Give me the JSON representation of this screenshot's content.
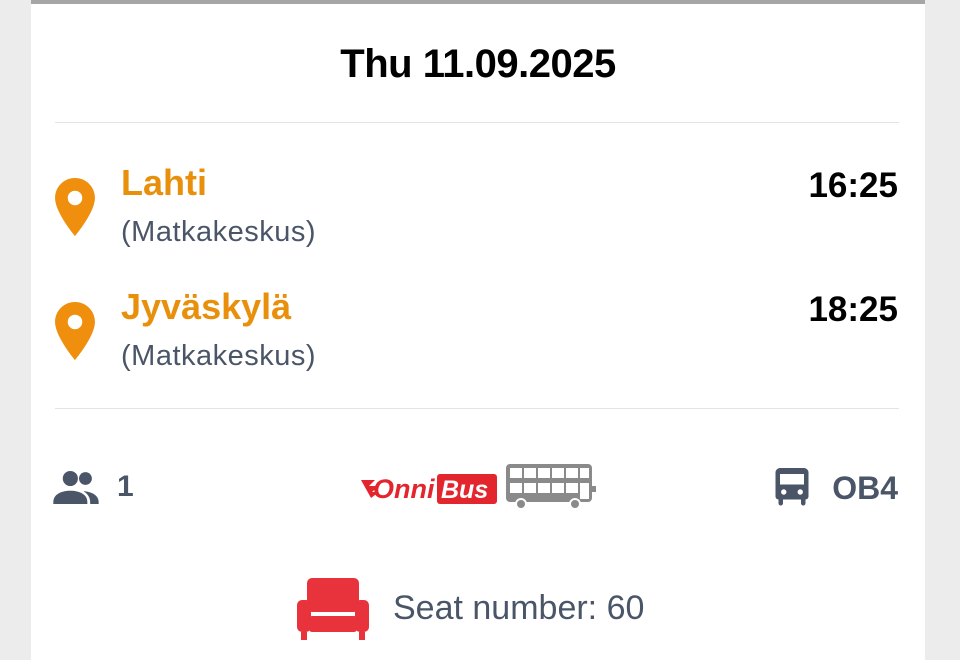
{
  "trip": {
    "date": "Thu 11.09.2025",
    "departure": {
      "city": "Lahti",
      "station": "(Matkakeskus)",
      "time": "16:25"
    },
    "arrival": {
      "city": "Jyväskylä",
      "station": "(Matkakeskus)",
      "time": "18:25"
    }
  },
  "details": {
    "passengers": "1",
    "operator_logo_text_onni": "Onni",
    "operator_logo_text_bus": "Bus",
    "line": "OB4",
    "seat_label": "Seat number: 60"
  },
  "colors": {
    "accent_orange": "#e8900c",
    "text_slate": "#4a5568",
    "seat_red": "#e8323c",
    "onnibus_red": "#e3262d"
  },
  "icons": {
    "location": "location-pin-icon",
    "people": "people-icon",
    "bus": "bus-icon",
    "seat": "seat-icon"
  }
}
